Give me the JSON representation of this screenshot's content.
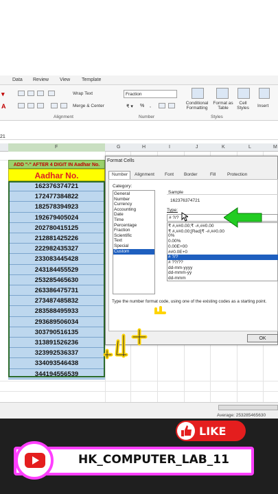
{
  "ribbon": {
    "tabs": [
      "Data",
      "Review",
      "View",
      "Template"
    ],
    "wrap_text": "Wrap Text",
    "merge_center": "Merge & Center",
    "number_format": "Fraction",
    "alignment_group": "Alignment",
    "number_group": "Number",
    "styles_group": "Styles",
    "conditional_formatting": "Conditional Formatting",
    "format_as_table": "Format as Table",
    "cell_styles": "Cell Styles",
    "insert": "Insert",
    "name_box_fragment": "21"
  },
  "columns": [
    "F",
    "G",
    "H",
    "I",
    "J",
    "K",
    "L",
    "M"
  ],
  "sheet": {
    "header_text": "ADD \"-\" AFTER 4 DIGIT IN Aadhar No.",
    "subheader_text": "Aadhar No.",
    "values": [
      "162376374721",
      "172477384822",
      "182578394923",
      "192679405024",
      "202780415125",
      "212881425226",
      "222982435327",
      "233083445428",
      "243184455529",
      "253285465630",
      "263386475731",
      "273487485832",
      "283588495933",
      "293689506034",
      "303790516135",
      "313891526236",
      "323992536337",
      "334093546438",
      "344194556539"
    ]
  },
  "dialog": {
    "title": "Format Cells",
    "tabs": [
      "Number",
      "Alignment",
      "Font",
      "Border",
      "Fill",
      "Protection"
    ],
    "category_label": "Category:",
    "categories": [
      "General",
      "Number",
      "Currency",
      "Accounting",
      "Date",
      "Time",
      "Percentage",
      "Fraction",
      "Scientific",
      "Text",
      "Special",
      "Custom"
    ],
    "selected_category": "Custom",
    "sample_label": "Sample",
    "sample_value": "162376374721",
    "type_label": "Type:",
    "type_value": "# ?/?",
    "format_codes": [
      "₹ #,##0.00;₹ -#,##0.00",
      "₹ #,##0.00;[Red]₹ -#,##0.00",
      "0%",
      "0.00%",
      "0.00E+00",
      "##0.0E+0",
      "# ?/?",
      "# ??/??",
      "dd-mm-yyyy",
      "dd-mmm-yy",
      "dd-mmm"
    ],
    "selected_code": "# ?/?",
    "hint": "Type the number format code, using one of the existing codes as a starting point.",
    "ok_label": "OK"
  },
  "status": {
    "average": "Average: 253285465630"
  },
  "overlay": {
    "like": "LIKE",
    "channel": "HK_COMPUTER_LAB_11",
    "arrow_color": "#22cc22",
    "accent_pink": "#ff3fff",
    "like_red": "#e41e1e"
  }
}
